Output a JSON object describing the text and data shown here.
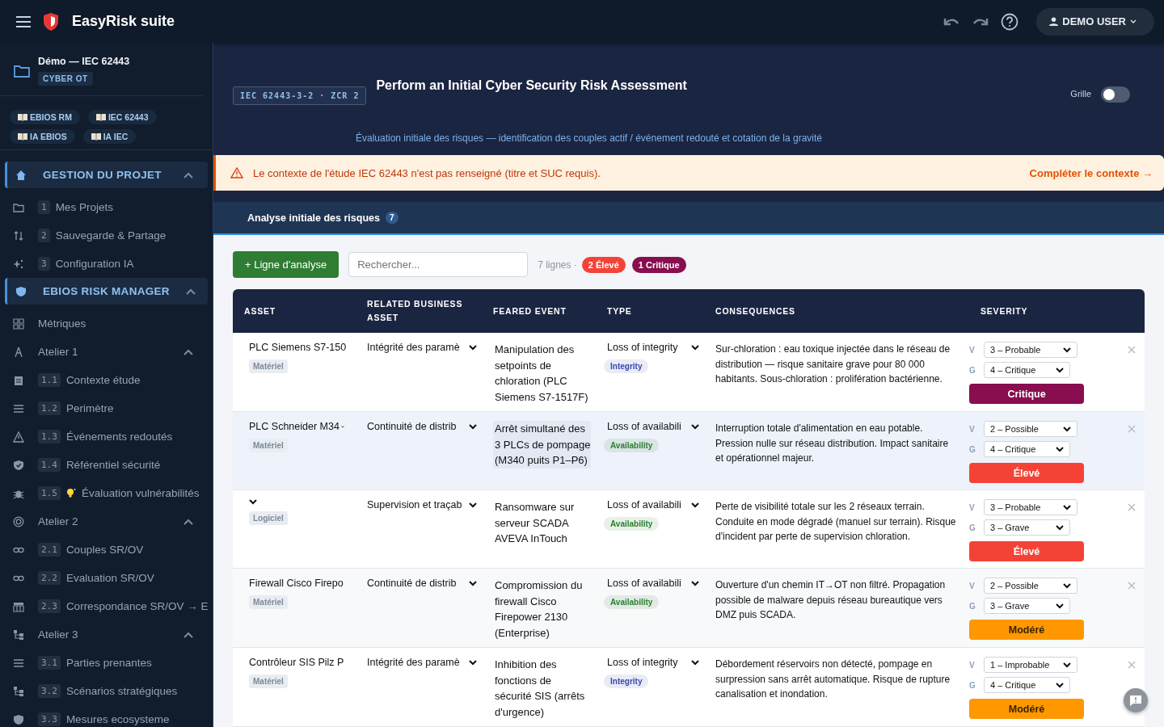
{
  "app": {
    "title": "EasyRisk suite",
    "user": "DEMO USER"
  },
  "sidebar": {
    "project": {
      "name": "Démo — IEC 62443",
      "tag": "CYBER OT"
    },
    "chips": [
      "EBIOS RM",
      "IEC 62443",
      "IA EBIOS",
      "IA IEC"
    ],
    "items": [
      {
        "kind": "section",
        "label": "GESTION DU PROJET",
        "expanded": true
      },
      {
        "kind": "item",
        "num": "1",
        "label": "Mes Projets"
      },
      {
        "kind": "item",
        "num": "2",
        "label": "Sauvegarde & Partage"
      },
      {
        "kind": "item",
        "num": "3",
        "label": "Configuration IA"
      },
      {
        "kind": "section",
        "label": "EBIOS RISK MANAGER",
        "expanded": true
      },
      {
        "kind": "plain",
        "label": "Métriques"
      },
      {
        "kind": "group",
        "label": "Atelier 1",
        "expanded": true
      },
      {
        "kind": "item",
        "num": "1.1",
        "label": "Contexte étude"
      },
      {
        "kind": "item",
        "num": "1.2",
        "label": "Perimètre"
      },
      {
        "kind": "item",
        "num": "1.3",
        "label": "Événements redoutés"
      },
      {
        "kind": "item",
        "num": "1.4",
        "label": "Référentiel sécurité"
      },
      {
        "kind": "item",
        "num": "1.5",
        "label": "Évaluation vulnérabilités",
        "hint": true
      },
      {
        "kind": "group",
        "label": "Atelier 2",
        "expanded": true
      },
      {
        "kind": "item",
        "num": "2.1",
        "label": "Couples SR/OV"
      },
      {
        "kind": "item",
        "num": "2.2",
        "label": "Evaluation SR/OV"
      },
      {
        "kind": "item",
        "num": "2.3",
        "label": "Correspondance SR/OV → E"
      },
      {
        "kind": "group",
        "label": "Atelier 3",
        "expanded": true
      },
      {
        "kind": "item",
        "num": "3.1",
        "label": "Parties prenantes"
      },
      {
        "kind": "item",
        "num": "3.2",
        "label": "Scénarios stratégiques"
      },
      {
        "kind": "item",
        "num": "3.3",
        "label": "Mesures ecosysteme"
      }
    ]
  },
  "header": {
    "reference": "IEC 62443-3-2 · ZCR 2",
    "title": "Perform an Initial Cyber Security Risk Assessment",
    "grid_toggle": {
      "label": "Grille",
      "on": false
    },
    "subtitle": "Évaluation initiale des risques — identification des couples actif / événement redouté et cotation de la gravité"
  },
  "alert": {
    "message": "Le contexte de l'étude IEC 62443 n'est pas renseigné (titre et SUC requis).",
    "action": "Compléter le contexte →"
  },
  "tabs": [
    {
      "label": "Analyse initiale des risques",
      "count": "7",
      "selected": true
    }
  ],
  "toolbar": {
    "add_button": "+ Ligne d'analyse",
    "search": {
      "placeholder": "Rechercher..."
    },
    "count": "7 lignes ·",
    "badges": [
      {
        "label": "2 Élevé",
        "color": "#f44336"
      },
      {
        "label": "1 Critique",
        "color": "#880e4f"
      }
    ]
  },
  "table": {
    "columns": [
      "ASSET",
      "RELATED BUSINESS ASSET",
      "FEARED EVENT",
      "TYPE",
      "CONSEQUENCES",
      "SEVERITY"
    ],
    "rows": [
      {
        "selected": false,
        "asset": "PLC Siemens S7-150",
        "asset_type": "Matériel",
        "business_asset": "Intégrité des paramè",
        "feared_event": "Manipulation des setpoints de chloration (PLC Siemens S7-1517F)",
        "type": "Loss of integrity",
        "type_tag": {
          "label": "Integrity",
          "color": "#3949ab"
        },
        "consequences": "Sur-chloration : eau toxique injectée dans le réseau de distribution — risque sanitaire grave pour 80 000 habitants. Sous-chloration : prolifération bactérienne.",
        "v_label": "V",
        "likelihood": "3 – Probable",
        "g_label": "G",
        "gravity": "4 – Critique",
        "severity": {
          "label": "Critique",
          "color": "#880e4f"
        }
      },
      {
        "selected": true,
        "asset": "PLC Schneider M34",
        "asset_type": "Matériel",
        "business_asset": "Continuité de distrib",
        "feared_event": "Arrêt simultané des 3 PLCs de pompage (M340 puits P1–P6)",
        "type": "Loss of availabili",
        "type_tag": {
          "label": "Availability",
          "color": "#2e7d32"
        },
        "consequences": "Interruption totale d'alimentation en eau potable. Pression nulle sur réseau distribution. Impact sanitaire et opérationnel majeur.",
        "v_label": "V",
        "likelihood": "2 – Possible",
        "g_label": "G",
        "gravity": "4 – Critique",
        "severity": {
          "label": "Élevé",
          "color": "#f44336"
        }
      },
      {
        "selected": false,
        "asset_type": "Logiciel",
        "business_asset": "Supervision et traçab",
        "feared_event": "Ransomware sur serveur SCADA AVEVA InTouch",
        "type": "Loss of availabili",
        "type_tag": {
          "label": "Availability",
          "color": "#2e7d32"
        },
        "consequences": "Perte de visibilité totale sur les 2 réseaux terrain. Conduite en mode dégradé (manuel sur terrain). Risque d'incident par perte de supervision chloration.",
        "v_label": "V",
        "likelihood": "3 – Probable",
        "g_label": "G",
        "gravity": "3 – Grave",
        "severity": {
          "label": "Élevé",
          "color": "#f44336"
        }
      },
      {
        "selected": false,
        "asset": "Firewall Cisco Firepo",
        "asset_type": "Matériel",
        "business_asset": "Continuité de distrib",
        "feared_event": "Compromission du firewall Cisco Firepower 2130 (Enterprise)",
        "type": "Loss of availabili",
        "type_tag": {
          "label": "Availability",
          "color": "#2e7d32"
        },
        "consequences": "Ouverture d'un chemin IT→OT non filtré. Propagation possible de malware depuis réseau bureautique vers DMZ puis SCADA.",
        "v_label": "V",
        "likelihood": "2 – Possible",
        "g_label": "G",
        "gravity": "3 – Grave",
        "severity": {
          "label": "Modéré",
          "color": "#ff9800"
        }
      },
      {
        "selected": false,
        "asset": "Contrôleur SIS Pilz P",
        "asset_type": "Matériel",
        "business_asset": "Intégrité des paramè",
        "feared_event": "Inhibition des fonctions de sécurité SIS (arrêts d'urgence)",
        "type": "Loss of integrity",
        "type_tag": {
          "label": "Integrity",
          "color": "#3949ab"
        },
        "consequences": "Débordement réservoirs non détecté, pompage en surpression sans arrêt automatique. Risque de rupture canalisation et inondation.",
        "v_label": "V",
        "likelihood": "1 – Improbable",
        "g_label": "G",
        "gravity": "4 – Critique",
        "severity": {
          "label": "Modéré",
          "color": "#ff9800"
        }
      }
    ]
  }
}
